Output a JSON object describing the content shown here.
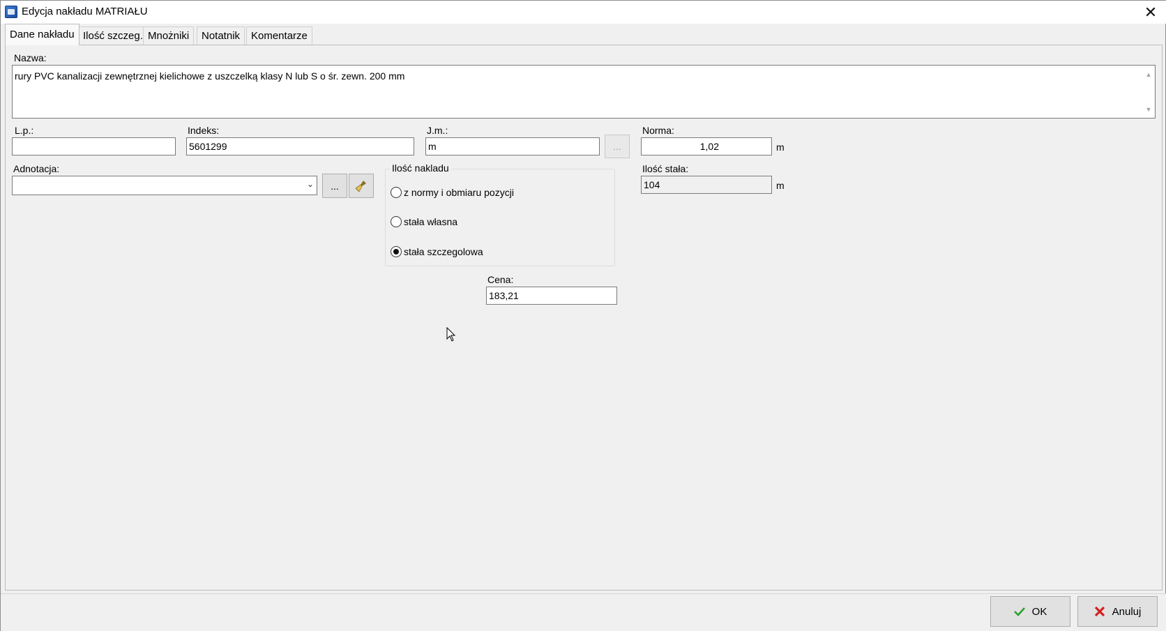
{
  "window": {
    "title": "Edycja nakładu MATRIAŁU",
    "accent_icon": "app-icon",
    "close_glyph": "✕"
  },
  "tabs": [
    {
      "label": "Dane nakładu",
      "active": true
    },
    {
      "label": "Ilość szczeg."
    },
    {
      "label": "Mnożniki"
    },
    {
      "label": "Notatnik"
    },
    {
      "label": "Komentarze"
    }
  ],
  "form": {
    "name_label": "Nazwa:",
    "name_value": "rury PVC kanalizacji zewnętrznej kielichowe z uszczelką klasy N lub S o śr. zewn. 200 mm",
    "lp_label": "L.p.:",
    "lp_value": "",
    "index_label": "Indeks:",
    "index_value": "5601299",
    "jm_label": "J.m.:",
    "jm_value": "m",
    "jm_button": "...",
    "norma_label": "Norma:",
    "norma_value": "1,02",
    "norma_unit": "m",
    "adnotacja_label": "Adnotacja:",
    "adnotacja_value": "",
    "adnotacja_button": "...",
    "ilosc_group_title": "Ilość nakladu",
    "radio_options": [
      {
        "label": "z normy i obmiaru pozycji",
        "checked": false
      },
      {
        "label": "stała własna",
        "checked": false
      },
      {
        "label": "stała szczegolowa",
        "checked": true
      }
    ],
    "ilosc_stala_label": "Ilość stała:",
    "ilosc_stala_value": "104",
    "ilosc_stala_unit": "m",
    "cena_label": "Cena:",
    "cena_value": "183,21"
  },
  "footer": {
    "ok_label": "OK",
    "cancel_label": "Anuluj",
    "ok_icon_color": "#2e9e2e",
    "cancel_icon_color": "#d42020"
  }
}
